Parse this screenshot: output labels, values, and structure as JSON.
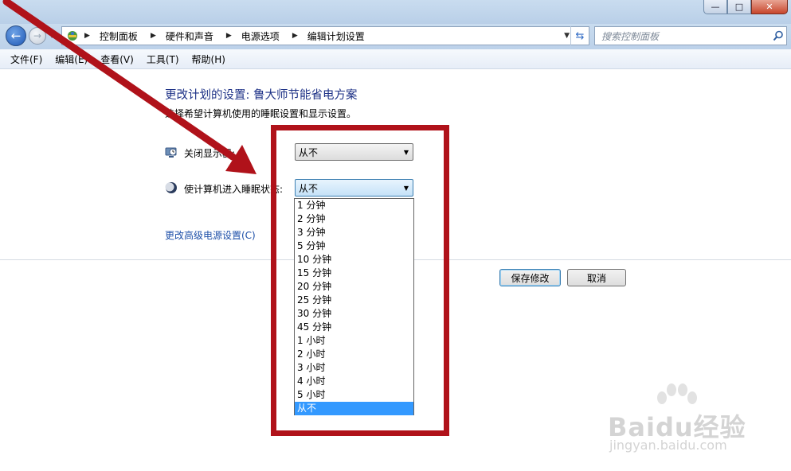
{
  "window": {
    "minimize_label": "—",
    "maximize_label": "□",
    "close_label": "✕"
  },
  "address": {
    "breadcrumbs": [
      "控制面板",
      "硬件和声音",
      "电源选项",
      "编辑计划设置"
    ]
  },
  "search": {
    "placeholder": "搜索控制面板"
  },
  "menu": [
    "文件(F)",
    "编辑(E)",
    "查看(V)",
    "工具(T)",
    "帮助(H)"
  ],
  "content": {
    "heading": "更改计划的设置: 鲁大师节能省电方案",
    "subtext": "选择希望计算机使用的睡眠设置和显示设置。",
    "display_off_label": "关闭显示器:",
    "display_off_value": "从不",
    "sleep_label": "使计算机进入睡眠状态:",
    "sleep_value": "从不",
    "advanced_link": "更改高级电源设置(C)",
    "save_button": "保存修改",
    "cancel_button": "取消"
  },
  "dropdown_options": [
    "1 分钟",
    "2 分钟",
    "3 分钟",
    "5 分钟",
    "10 分钟",
    "15 分钟",
    "20 分钟",
    "25 分钟",
    "30 分钟",
    "45 分钟",
    "1 小时",
    "2 小时",
    "3 小时",
    "4 小时",
    "5 小时",
    "从不"
  ],
  "dropdown_selected": "从不",
  "watermark": {
    "brand": "Baidu经验",
    "url": "jingyan.baidu.com"
  },
  "colors": {
    "annotation_red": "#b0121a",
    "selection_blue": "#3399ff",
    "heading_blue": "#1e3287"
  }
}
